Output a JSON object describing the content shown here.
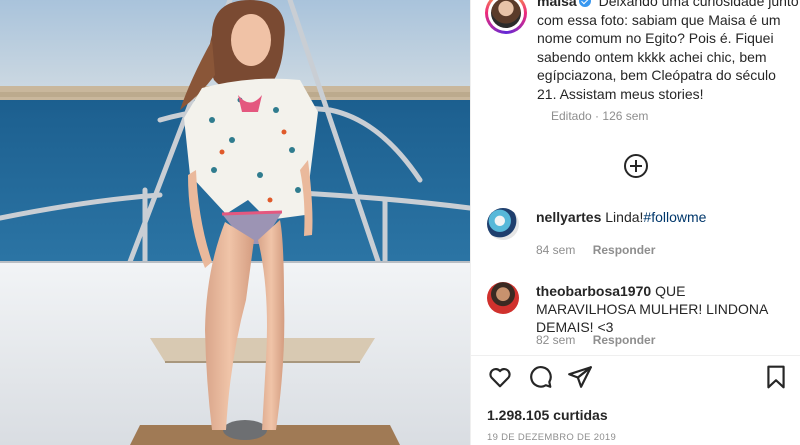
{
  "post": {
    "username": "maisa",
    "caption": "Deixando uma curiosidade junto com essa foto: sabiam que Maisa é um nome comum no Egito? Pois é. Fiquei sabendo ontem kkkk achei chic, bem egípciazona, bem Cleópatra do século 21. Assistam meus stories!",
    "edited_label": "Editado",
    "time_ago": "126 sem",
    "likes": "1.298.105 curtidas",
    "date": "19 DE DEZEMBRO DE 2019"
  },
  "comments": [
    {
      "username": "nellyartes",
      "text": "Linda!",
      "hashtag": "#followme",
      "time": "84 sem",
      "reply_label": "Responder"
    },
    {
      "username": "theobarbosa1970",
      "text": "QUE MARAVILHOSA MULHER! LINDONA DEMAIS! <3",
      "hashtag": "",
      "time": "82 sem",
      "reply_label": "Responder"
    }
  ],
  "icons": {
    "verified": "verified-badge-icon",
    "load_more": "plus-circle-icon",
    "like": "heart-icon",
    "comment": "comment-bubble-icon",
    "share": "paper-plane-icon",
    "save": "bookmark-icon"
  },
  "colors": {
    "verified": "#3897f0",
    "text": "#262626",
    "muted": "#8e8e8e",
    "hashtag": "#00376b"
  }
}
